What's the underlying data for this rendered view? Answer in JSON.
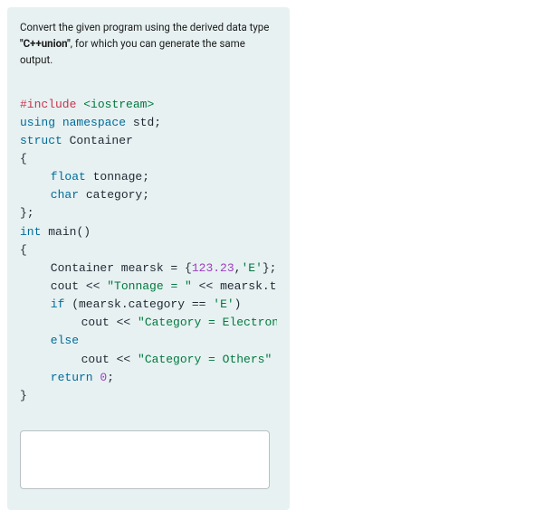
{
  "prompt": {
    "line1": "Convert the given program using the derived data type",
    "keyword": "\"C++union\"",
    "line2a": ", for which you can generate the same",
    "line3": "output."
  },
  "code": {
    "l1_pp": "#include",
    "l1_inc": "<iostream>",
    "l2_kw": "using",
    "l2_kw2": "namespace",
    "l2_id": "std",
    "l2_end": ";",
    "l3_kw": "struct",
    "l3_id": "Container",
    "l4": "{",
    "l5_ty": "float",
    "l5_id": "tonnage",
    "l5_end": ";",
    "l6_ty": "char",
    "l6_id": "category",
    "l6_end": ";",
    "l7": "};",
    "l8_ty": "int",
    "l8_id": "main",
    "l8_par": "()",
    "l9": "{",
    "l10_id": "Container mearsk",
    "l10_eq": " = ",
    "l10_br": "{",
    "l10_num": "123.23",
    "l10_c": ",",
    "l10_chr": "'E'",
    "l10_br2": "};",
    "l11_id": "cout",
    "l11_op": " << ",
    "l11_str": "\"Tonnage = \"",
    "l11_op2": " << ",
    "l11_id2": "mearsk.t",
    "l12_kw": "if",
    "l12_rest1": " (mearsk.category ",
    "l12_op": "==",
    "l12_sp": " ",
    "l12_chr": "'E'",
    "l12_rest2": ")",
    "l13_id": "cout",
    "l13_op": " << ",
    "l13_str": "\"Category = Electron",
    "l14_kw": "else",
    "l15_id": "cout",
    "l15_op": " << ",
    "l15_str": "\"Category = Others\"",
    "l16_kw": "return",
    "l16_sp": " ",
    "l16_num": "0",
    "l16_end": ";",
    "l17": "}"
  },
  "answer": {
    "placeholder": ""
  }
}
